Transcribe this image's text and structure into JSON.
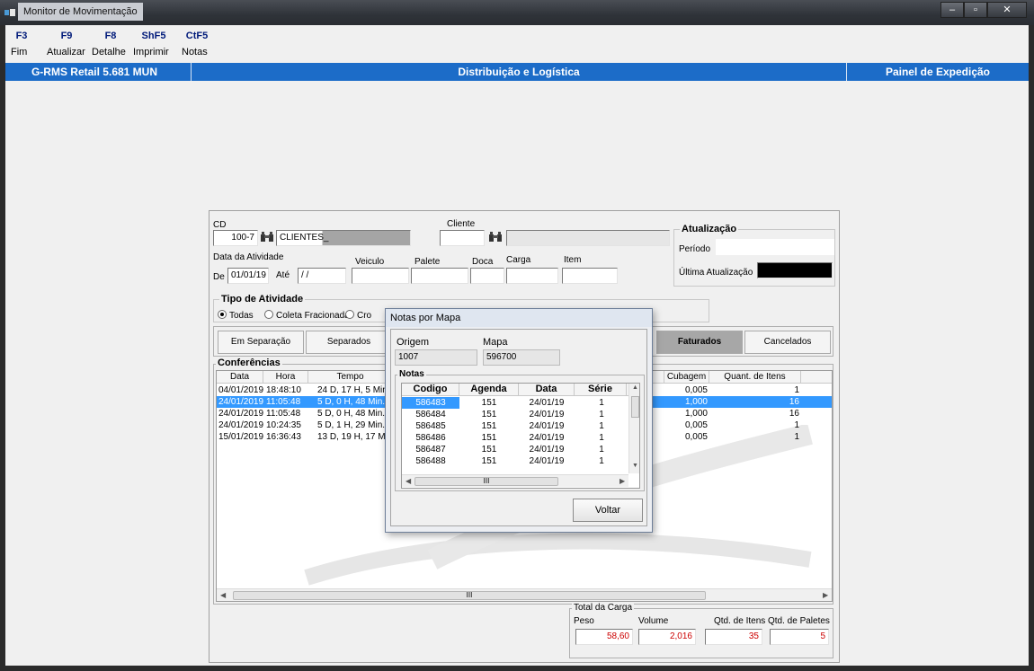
{
  "window": {
    "title": "Monitor de Movimentação",
    "buttons": {
      "minimize": "–",
      "restore": "▫",
      "close": "✕"
    }
  },
  "toolbar": [
    {
      "key": "F3",
      "label": "Fim"
    },
    {
      "key": "F9",
      "label": "Atualizar"
    },
    {
      "key": "F8",
      "label": "Detalhe"
    },
    {
      "key": "ShF5",
      "label": "Imprimir"
    },
    {
      "key": "CtF5",
      "label": "Notas"
    }
  ],
  "infobar": {
    "version": "G-RMS Retail 5.681 MUN",
    "module": "Distribuição e Logística",
    "panel": "Painel de Expedição"
  },
  "filters": {
    "cd_label": "CD",
    "cd_value": "100-7",
    "cd_name": "CLIENTES_",
    "cliente_label": "Cliente",
    "cliente_value": "",
    "data_atividade_label": "Data da Atividade",
    "de_label": "De",
    "de_value": "01/01/19",
    "ate_label": "Até",
    "ate_value": " / /",
    "veiculo_label": "Veiculo",
    "palete_label": "Palete",
    "doca_label": "Doca",
    "carga_label": "Carga",
    "item_label": "Item"
  },
  "atualizacao": {
    "title": "Atualização",
    "periodo_label": "Período",
    "ultima_label": "Última Atualização"
  },
  "tipo_atividade": {
    "title": "Tipo de Atividade",
    "options": [
      "Todas",
      "Coleta Fracionada",
      "Cro"
    ],
    "selected": "Todas"
  },
  "status_tabs": [
    "Em Separação",
    "Separados",
    "Faturados",
    "Cancelados"
  ],
  "active_tab": "Faturados",
  "conferencias": {
    "title": "Conferências",
    "columns": [
      "Data",
      "Hora",
      "Tempo",
      "Cubagem",
      "Quant. de Itens"
    ],
    "rows": [
      {
        "data": "04/01/2019",
        "hora": "18:48:10",
        "tempo": "24 D, 17 H, 5 Min.",
        "cubagem": "0,005",
        "itens": "1",
        "selected": false
      },
      {
        "data": "24/01/2019",
        "hora": "11:05:48",
        "tempo": "5 D, 0 H, 48 Min.",
        "cubagem": "1,000",
        "itens": "16",
        "selected": true
      },
      {
        "data": "24/01/2019",
        "hora": "11:05:48",
        "tempo": "5 D, 0 H, 48 Min.",
        "cubagem": "1,000",
        "itens": "16",
        "selected": false
      },
      {
        "data": "24/01/2019",
        "hora": "10:24:35",
        "tempo": "5 D, 1 H, 29 Min.",
        "cubagem": "0,005",
        "itens": "1",
        "selected": false
      },
      {
        "data": "15/01/2019",
        "hora": "16:36:43",
        "tempo": "13 D, 19 H, 17 Min.",
        "cubagem": "0,005",
        "itens": "1",
        "selected": false
      }
    ],
    "scroll_thumb": "III"
  },
  "total_carga": {
    "title": "Total da Carga",
    "peso_label": "Peso",
    "peso": "58,60",
    "volume_label": "Volume",
    "volume": "2,016",
    "itens_label": "Qtd. de Itens",
    "itens": "35",
    "paletes_label": "Qtd. de Paletes",
    "paletes": "5"
  },
  "dialog": {
    "title": "Notas por Mapa",
    "origem_label": "Origem",
    "origem": "1007",
    "mapa_label": "Mapa",
    "mapa": "596700",
    "notas_title": "Notas",
    "columns": [
      "Codigo",
      "Agenda",
      "Data",
      "Série"
    ],
    "rows": [
      {
        "codigo": "586483",
        "agenda": "151",
        "data": "24/01/19",
        "serie": "1",
        "selected": true
      },
      {
        "codigo": "586484",
        "agenda": "151",
        "data": "24/01/19",
        "serie": "1",
        "selected": false
      },
      {
        "codigo": "586485",
        "agenda": "151",
        "data": "24/01/19",
        "serie": "1",
        "selected": false
      },
      {
        "codigo": "586486",
        "agenda": "151",
        "data": "24/01/19",
        "serie": "1",
        "selected": false
      },
      {
        "codigo": "586487",
        "agenda": "151",
        "data": "24/01/19",
        "serie": "1",
        "selected": false
      },
      {
        "codigo": "586488",
        "agenda": "151",
        "data": "24/01/19",
        "serie": "1",
        "selected": false
      }
    ],
    "scroll_thumb": "III",
    "voltar": "Voltar"
  },
  "colors": {
    "infobar": "#1c6cc8",
    "selection": "#3399ff",
    "total_text": "#cc0000",
    "toolbar_key": "#001a7a"
  }
}
